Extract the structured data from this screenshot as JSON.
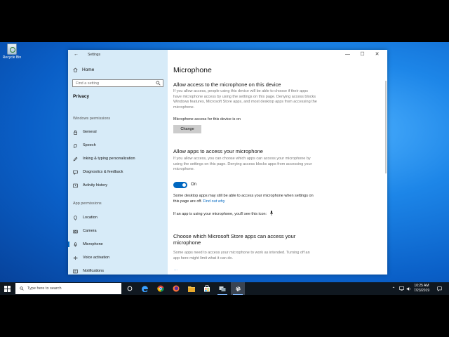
{
  "desktop": {
    "recycle_bin_label": "Recycle Bin"
  },
  "window": {
    "title": "Settings",
    "controls": {
      "minimize": "—",
      "maximize": "☐",
      "close": "✕"
    }
  },
  "sidebar": {
    "home_label": "Home",
    "search_placeholder": "Find a setting",
    "category": "Privacy",
    "sections": [
      {
        "title": "Windows permissions",
        "items": [
          {
            "label": "General",
            "icon": "lock-icon"
          },
          {
            "label": "Speech",
            "icon": "speech-icon"
          },
          {
            "label": "Inking & typing personalization",
            "icon": "inking-icon"
          },
          {
            "label": "Diagnostics & feedback",
            "icon": "feedback-icon"
          },
          {
            "label": "Activity history",
            "icon": "history-icon"
          }
        ]
      },
      {
        "title": "App permissions",
        "items": [
          {
            "label": "Location",
            "icon": "location-icon"
          },
          {
            "label": "Camera",
            "icon": "camera-icon"
          },
          {
            "label": "Microphone",
            "icon": "microphone-icon",
            "active": true
          },
          {
            "label": "Voice activation",
            "icon": "voice-activation-icon"
          },
          {
            "label": "Notifications",
            "icon": "notifications-icon"
          }
        ]
      }
    ]
  },
  "content": {
    "page_title": "Microphone",
    "device_heading": "Allow access to the microphone on this device",
    "device_desc": "If you allow access, people using this device will be able to choose if their apps have microphone access by using the settings on this page. Denying access blocks Windows features, Microsoft Store apps, and most desktop apps from accessing the microphone.",
    "device_status": "Microphone access for this device is on",
    "change_button": "Change",
    "apps_heading": "Allow apps to access your microphone",
    "apps_desc": "If you allow access, you can choose which apps can access your microphone by using the settings on this page. Denying access blocks apps from accessing your microphone.",
    "toggle_state": "On",
    "desktop_note": "Some desktop apps may still be able to access your microphone when settings on this page are off.",
    "find_out_why": "Find out why",
    "icon_note": "If an app is using your microphone, you'll see this icon:",
    "store_heading": "Choose which Microsoft Store apps can access your microphone",
    "store_desc": "Some apps need to access your microphone to work as intended. Turning off an app here might limit what it can do."
  },
  "taskbar": {
    "search_placeholder": "Type here to search",
    "clock_time": "10:25 AM",
    "clock_date": "7/23/2019",
    "colors": {
      "bar": "#101820",
      "accent": "#0067c0"
    }
  }
}
